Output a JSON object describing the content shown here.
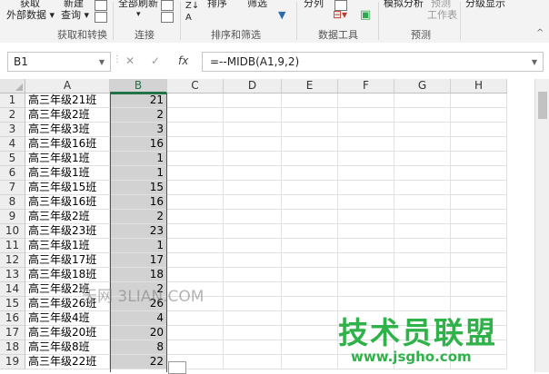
{
  "ribbon": {
    "get_data": [
      "获取",
      "外部数据 ▾"
    ],
    "new_query": [
      "新建",
      "查询 ▾"
    ],
    "refresh_all": "全部刷新",
    "sort": "排序",
    "filter": "筛选",
    "split": "分列",
    "what_if": "模拟分析",
    "forecast": [
      "预测",
      "工作表"
    ],
    "outline": "分级显示",
    "groups": [
      "获取和转换",
      "连接",
      "排序和筛选",
      "数据工具",
      "预测"
    ]
  },
  "formula_bar": {
    "name_box": "B1",
    "cancel": "✕",
    "enter": "✓",
    "fx": "fx",
    "formula": "=--MIDB(A1,9,2)"
  },
  "columns": [
    "A",
    "B",
    "C",
    "D",
    "E",
    "F",
    "G",
    "H"
  ],
  "rows": [
    {
      "n": "1",
      "a": "高三年级21班",
      "b": "21"
    },
    {
      "n": "2",
      "a": "高三年级2班",
      "b": "2"
    },
    {
      "n": "3",
      "a": "高三年级3班",
      "b": "3"
    },
    {
      "n": "4",
      "a": "高三年级16班",
      "b": "16"
    },
    {
      "n": "5",
      "a": "高三年级1班",
      "b": "1"
    },
    {
      "n": "6",
      "a": "高三年级1班",
      "b": "1"
    },
    {
      "n": "7",
      "a": "高三年级15班",
      "b": "15"
    },
    {
      "n": "8",
      "a": "高三年级16班",
      "b": "16"
    },
    {
      "n": "9",
      "a": "高三年级2班",
      "b": "2"
    },
    {
      "n": "10",
      "a": "高三年级23班",
      "b": "23"
    },
    {
      "n": "11",
      "a": "高三年级1班",
      "b": "1"
    },
    {
      "n": "12",
      "a": "高三年级17班",
      "b": "17"
    },
    {
      "n": "13",
      "a": "高三年级18班",
      "b": "18"
    },
    {
      "n": "14",
      "a": "高三年级2班",
      "b": "2"
    },
    {
      "n": "15",
      "a": "高三年级26班",
      "b": "26"
    },
    {
      "n": "16",
      "a": "高三年级4班",
      "b": "4"
    },
    {
      "n": "17",
      "a": "高三年级20班",
      "b": "20"
    },
    {
      "n": "18",
      "a": "高三年级8班",
      "b": "8"
    },
    {
      "n": "19",
      "a": "高三年级22班",
      "b": "22"
    }
  ],
  "watermarks": {
    "faint": "天网 3LIAN.COM",
    "brand": "技术员联盟",
    "url": "www.jsgho.com"
  },
  "colors": {
    "accent": "#217346",
    "selection": "#d2d2d2",
    "brand": "#2fb24a"
  }
}
